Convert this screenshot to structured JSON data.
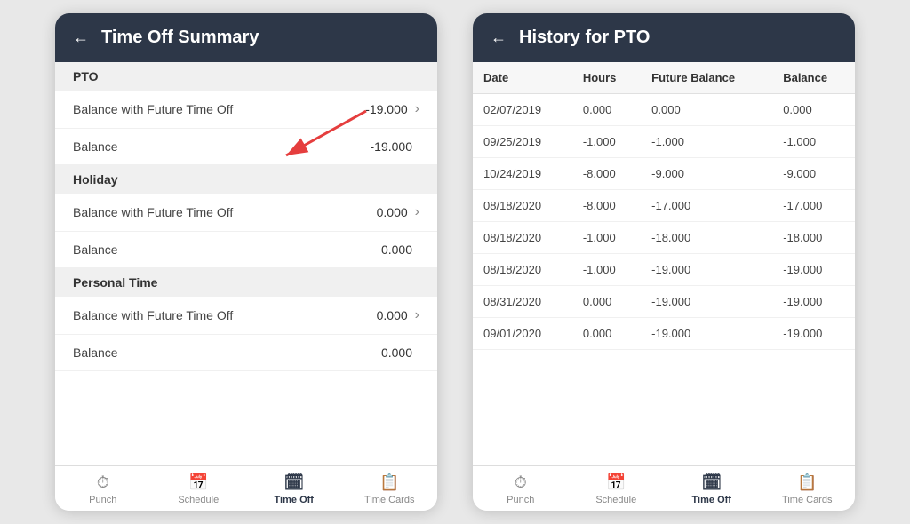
{
  "leftPanel": {
    "header": {
      "back_label": "←",
      "title": "Time Off Summary"
    },
    "sections": [
      {
        "id": "pto",
        "label": "PTO",
        "rows": [
          {
            "id": "pto-bwfto",
            "label": "Balance with Future Time Off",
            "value": "-19.000",
            "hasChevron": true
          },
          {
            "id": "pto-balance",
            "label": "Balance",
            "value": "-19.000",
            "hasChevron": false
          }
        ]
      },
      {
        "id": "holiday",
        "label": "Holiday",
        "rows": [
          {
            "id": "holiday-bwfto",
            "label": "Balance with Future Time Off",
            "value": "0.000",
            "hasChevron": true
          },
          {
            "id": "holiday-balance",
            "label": "Balance",
            "value": "0.000",
            "hasChevron": false
          }
        ]
      },
      {
        "id": "personal",
        "label": "Personal Time",
        "rows": [
          {
            "id": "personal-bwfto",
            "label": "Balance with Future Time Off",
            "value": "0.000",
            "hasChevron": true
          },
          {
            "id": "personal-balance",
            "label": "Balance",
            "value": "0.000",
            "hasChevron": false
          }
        ]
      }
    ],
    "nav": [
      {
        "id": "punch",
        "icon": "⏱",
        "label": "Punch",
        "active": false
      },
      {
        "id": "schedule",
        "icon": "📅",
        "label": "Schedule",
        "active": false
      },
      {
        "id": "timeoff",
        "icon": "🗓",
        "label": "Time Off",
        "active": true
      },
      {
        "id": "timecards",
        "icon": "📋",
        "label": "Time Cards",
        "active": false
      }
    ]
  },
  "rightPanel": {
    "header": {
      "back_label": "←",
      "title": "History for PTO"
    },
    "table": {
      "columns": [
        "Date",
        "Hours",
        "Future Balance",
        "Balance"
      ],
      "rows": [
        {
          "date": "02/07/2019",
          "hours": "0.000",
          "future_balance": "0.000",
          "balance": "0.000"
        },
        {
          "date": "09/25/2019",
          "hours": "-1.000",
          "future_balance": "-1.000",
          "balance": "-1.000"
        },
        {
          "date": "10/24/2019",
          "hours": "-8.000",
          "future_balance": "-9.000",
          "balance": "-9.000"
        },
        {
          "date": "08/18/2020",
          "hours": "-8.000",
          "future_balance": "-17.000",
          "balance": "-17.000"
        },
        {
          "date": "08/18/2020",
          "hours": "-1.000",
          "future_balance": "-18.000",
          "balance": "-18.000"
        },
        {
          "date": "08/18/2020",
          "hours": "-1.000",
          "future_balance": "-19.000",
          "balance": "-19.000"
        },
        {
          "date": "08/31/2020",
          "hours": "0.000",
          "future_balance": "-19.000",
          "balance": "-19.000"
        },
        {
          "date": "09/01/2020",
          "hours": "0.000",
          "future_balance": "-19.000",
          "balance": "-19.000"
        }
      ]
    },
    "nav": [
      {
        "id": "punch",
        "icon": "⏱",
        "label": "Punch",
        "active": false
      },
      {
        "id": "schedule",
        "icon": "📅",
        "label": "Schedule",
        "active": false
      },
      {
        "id": "timeoff",
        "icon": "🗓",
        "label": "Time Off",
        "active": true
      },
      {
        "id": "timecards",
        "icon": "📋",
        "label": "Time Cards",
        "active": false
      }
    ]
  }
}
